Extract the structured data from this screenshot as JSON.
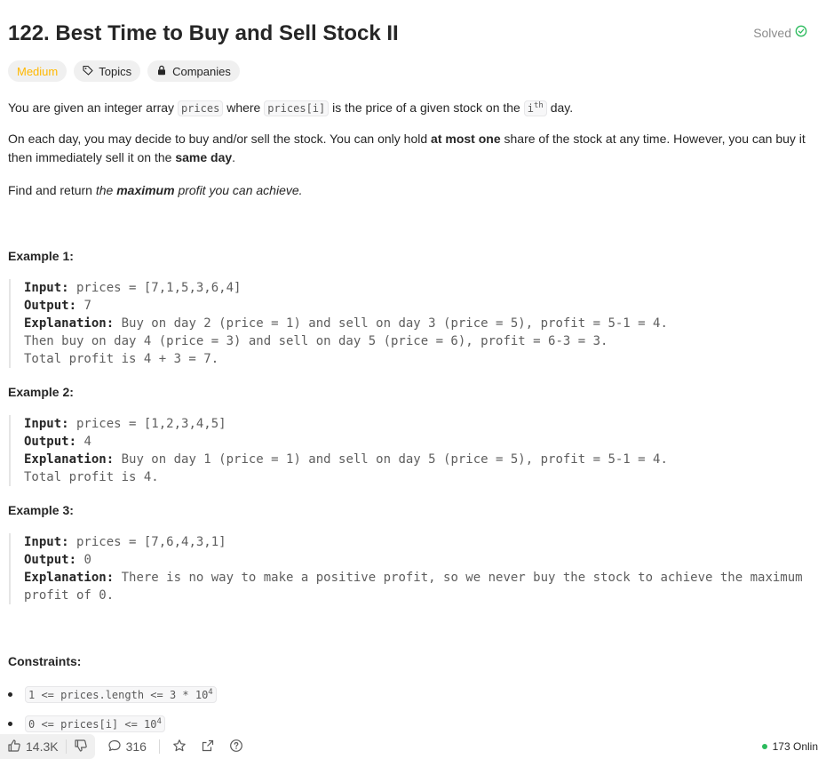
{
  "header": {
    "title": "122. Best Time to Buy and Sell Stock II",
    "status": "Solved",
    "status_icon": "check-circle-icon",
    "status_color": "#2cbb5d"
  },
  "tags": {
    "difficulty": "Medium",
    "difficulty_color": "#ffb800",
    "topics": "Topics",
    "companies": "Companies"
  },
  "description": {
    "p1": {
      "a": "You are given an integer array ",
      "code1": "prices",
      "b": " where ",
      "code2": "prices[i]",
      "c": " is the price of a given stock on the ",
      "code3": "i",
      "sup": "th",
      "d": " day."
    },
    "p2": {
      "a": "On each day, you may decide to buy and/or sell the stock. You can only hold ",
      "bold1": "at most one",
      "b": " share of the stock at any time. However, you can buy it then immediately sell it on the ",
      "bold2": "same day",
      "c": "."
    },
    "p3": {
      "a": "Find and return ",
      "i1": "the ",
      "bold": "maximum",
      "i2": " profit you can achieve."
    }
  },
  "examples": [
    {
      "title": "Example 1:",
      "input_label": "Input:",
      "input": " prices = [7,1,5,3,6,4]",
      "output_label": "Output:",
      "output": " 7",
      "explanation_label": "Explanation:",
      "explanation": " Buy on day 2 (price = 1) and sell on day 3 (price = 5), profit = 5-1 = 4.\nThen buy on day 4 (price = 3) and sell on day 5 (price = 6), profit = 6-3 = 3.\nTotal profit is 4 + 3 = 7."
    },
    {
      "title": "Example 2:",
      "input_label": "Input:",
      "input": " prices = [1,2,3,4,5]",
      "output_label": "Output:",
      "output": " 4",
      "explanation_label": "Explanation:",
      "explanation": " Buy on day 1 (price = 1) and sell on day 5 (price = 5), profit = 5-1 = 4.\nTotal profit is 4."
    },
    {
      "title": "Example 3:",
      "input_label": "Input:",
      "input": " prices = [7,6,4,3,1]",
      "output_label": "Output:",
      "output": " 0",
      "explanation_label": "Explanation:",
      "explanation": " There is no way to make a positive profit, so we never buy the stock to achieve the maximum profit of 0."
    }
  ],
  "constraints": {
    "title": "Constraints:",
    "c1": {
      "text": "1 <= prices.length <= 3 * 10",
      "sup": "4"
    },
    "c2": {
      "text": "0 <= prices[i] <= 10",
      "sup": "4"
    }
  },
  "footer": {
    "likes": "14.3K",
    "comments": "316",
    "online": "173 Onlin",
    "online_color": "#2cbb5d"
  }
}
